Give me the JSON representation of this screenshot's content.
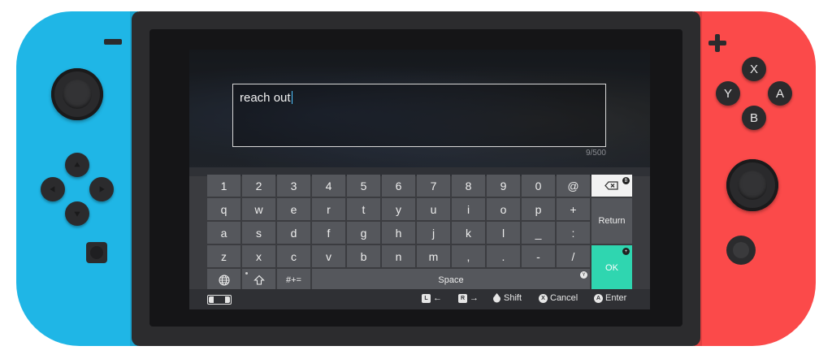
{
  "console": {
    "left_joycon": {
      "color": "#1fb6e6"
    },
    "right_joycon": {
      "color": "#fb4a4a"
    },
    "face_buttons": {
      "x": "X",
      "y": "Y",
      "a": "A",
      "b": "B"
    }
  },
  "textbox": {
    "value": "reach out",
    "char_count": "9/500"
  },
  "keyboard": {
    "rows": [
      [
        "1",
        "2",
        "3",
        "4",
        "5",
        "6",
        "7",
        "8",
        "9",
        "0",
        "@"
      ],
      [
        "q",
        "w",
        "e",
        "r",
        "t",
        "y",
        "u",
        "i",
        "o",
        "p",
        "+"
      ],
      [
        "a",
        "s",
        "d",
        "f",
        "g",
        "h",
        "j",
        "k",
        "l",
        "_",
        ":"
      ],
      [
        "z",
        "x",
        "c",
        "v",
        "b",
        "n",
        "m",
        ",",
        ".",
        "-",
        "/"
      ]
    ],
    "return_label": "Return",
    "ok_label": "OK",
    "symbols_label": "#+=",
    "space_label": "Space",
    "backspace_badge": "B",
    "ok_badge": "+",
    "space_badge": "Y"
  },
  "footer": {
    "l_tag": "L",
    "l_label": "←",
    "r_tag": "R",
    "r_label": "→",
    "shift_label": "Shift",
    "cancel_tag": "X",
    "cancel_label": "Cancel",
    "enter_tag": "A",
    "enter_label": "Enter"
  },
  "colors": {
    "accent_ok": "#2fd6b0",
    "caret": "#4fc3ff"
  }
}
